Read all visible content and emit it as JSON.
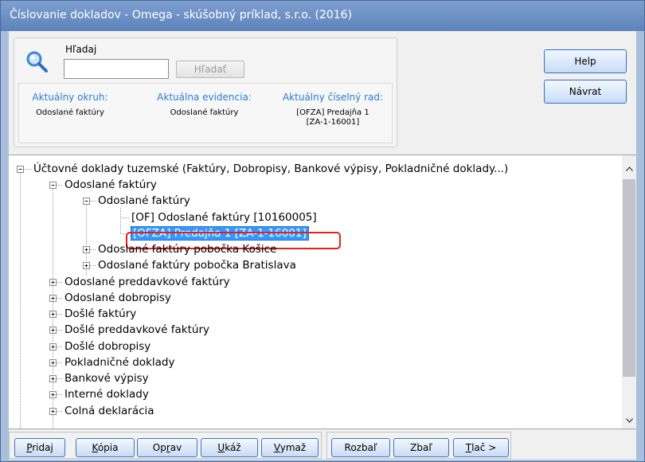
{
  "window": {
    "title": "Číslovanie dokladov - Omega - skúšobný príklad, s.r.o. (2016)"
  },
  "search": {
    "label": "Hľadaj",
    "value": "",
    "button_label": "Hľadať"
  },
  "info": {
    "range_label": "Aktuálny okruh:",
    "range_value": "Odoslané faktúry",
    "evidence_label": "Aktuálna evidencia:",
    "evidence_value": "Odoslané faktúry",
    "series_label": "Aktuálny číselný rad:",
    "series_value_line1": "[OFZA] Predajňa 1",
    "series_value_line2": "[ZA-1-16001]"
  },
  "buttons": {
    "help": "Help",
    "return": "Návrat"
  },
  "tree": {
    "items": [
      {
        "label": "Účtovné doklady tuzemské (Faktúry, Dobropisy, Bankové výpisy, Pokladničné doklady...)",
        "expander": "minus"
      },
      {
        "label": "Odoslané faktúry",
        "expander": "minus"
      },
      {
        "label": "Odoslané faktúry",
        "expander": "minus"
      },
      {
        "label": "[OF] Odoslané faktúry [10160005]",
        "expander": "none"
      },
      {
        "label": "[OFZA] Predajňa 1 [ZA-1-16001]",
        "expander": "none",
        "selected": true
      },
      {
        "label": "Odoslané faktúry pobočka Košice",
        "expander": "plus"
      },
      {
        "label": "Odoslané faktúry pobočka Bratislava",
        "expander": "plus"
      },
      {
        "label": "Odoslané preddavkové faktúry",
        "expander": "plus"
      },
      {
        "label": "Odoslané dobropisy",
        "expander": "plus"
      },
      {
        "label": "Došlé faktúry",
        "expander": "plus"
      },
      {
        "label": "Došlé preddavkové faktúry",
        "expander": "plus"
      },
      {
        "label": "Došlé dobropisy",
        "expander": "plus"
      },
      {
        "label": "Pokladničné doklady",
        "expander": "plus"
      },
      {
        "label": "Bankové výpisy",
        "expander": "plus"
      },
      {
        "label": "Interné doklady",
        "expander": "plus"
      },
      {
        "label": "Colná deklarácia",
        "expander": "plus"
      }
    ]
  },
  "toolbar": {
    "add": {
      "mnemonic": "P",
      "rest": "ridaj"
    },
    "copy": {
      "mnemonic": "K",
      "rest": "ópia"
    },
    "edit_a": "Op",
    "edit_m": "r",
    "edit_b": "av",
    "show_a": "U",
    "show_rest": "káž",
    "delete": {
      "mnemonic": "V",
      "rest": "ymaž"
    },
    "expand": "Rozbaľ",
    "collapse": "Zbaľ",
    "print": {
      "mnemonic": "T",
      "rest": "lač >"
    }
  },
  "colors": {
    "accent_label": "#2c7ad6",
    "selection": "#3399ff",
    "annotation": "#e0221f"
  }
}
